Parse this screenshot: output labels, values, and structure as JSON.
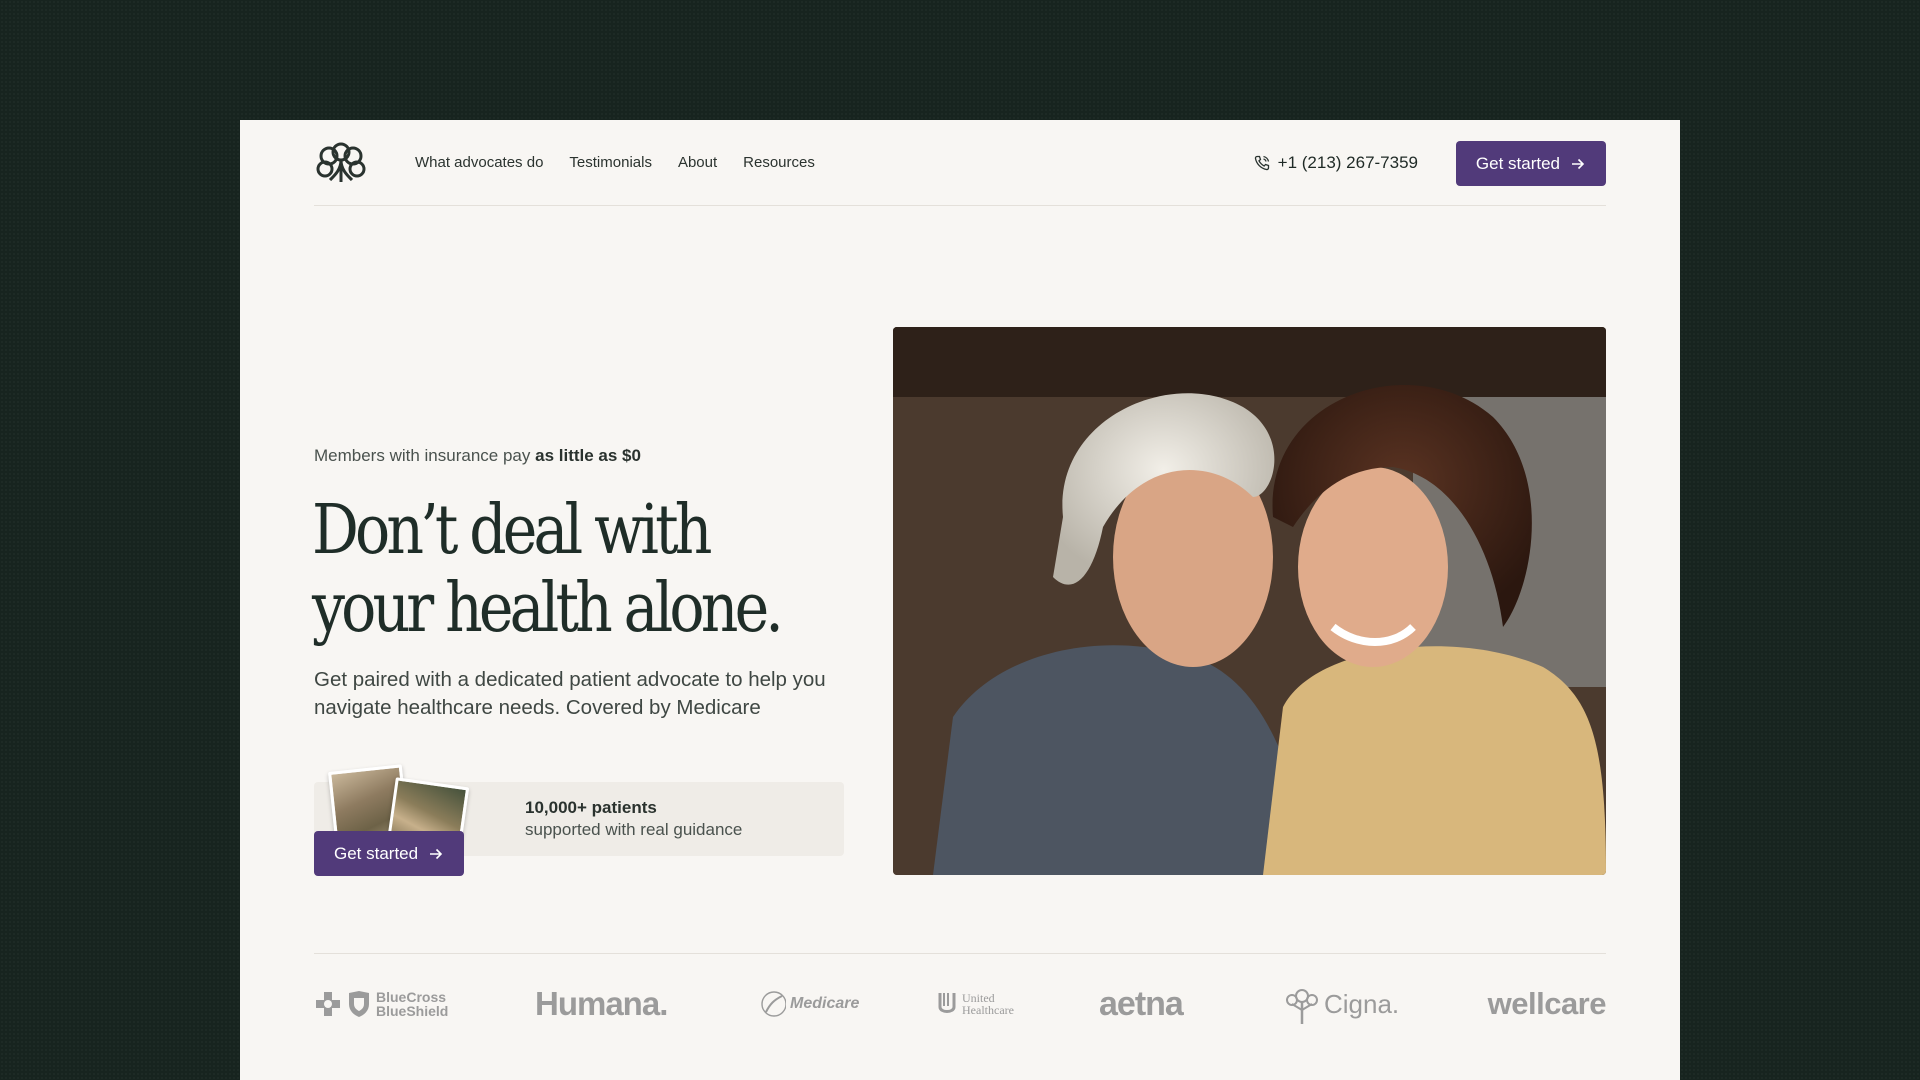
{
  "nav": {
    "links": [
      "What advocates do",
      "Testimonials",
      "About",
      "Resources"
    ],
    "phone": "+1 (213) 267-7359",
    "cta_label": "Get started"
  },
  "hero": {
    "eyebrow_prefix": "Members with insurance pay",
    "eyebrow_emphasis": "as little as $0",
    "headline": "Don’t deal with your health alone.",
    "subhead": "Get paired with a dedicated patient advocate to help you navigate healthcare needs. Covered by Medicare",
    "proof_title": "10,000+ patients",
    "proof_desc": "supported with real guidance",
    "cta_label": "Get started"
  },
  "partners": {
    "bcbs_line1": "BlueCross",
    "bcbs_line2": "BlueShield",
    "humana": "Humana.",
    "medicare": "Medicare",
    "uhc_line1": "United",
    "uhc_line2": "Healthcare",
    "aetna": "aetna",
    "cigna": "Cigna.",
    "wellcare": "wellcare"
  },
  "colors": {
    "background": "#17241f",
    "page": "#f8f6f3",
    "accent": "#513a7a",
    "headline": "#1f2d28",
    "logo_gray": "#9b9b9b"
  }
}
